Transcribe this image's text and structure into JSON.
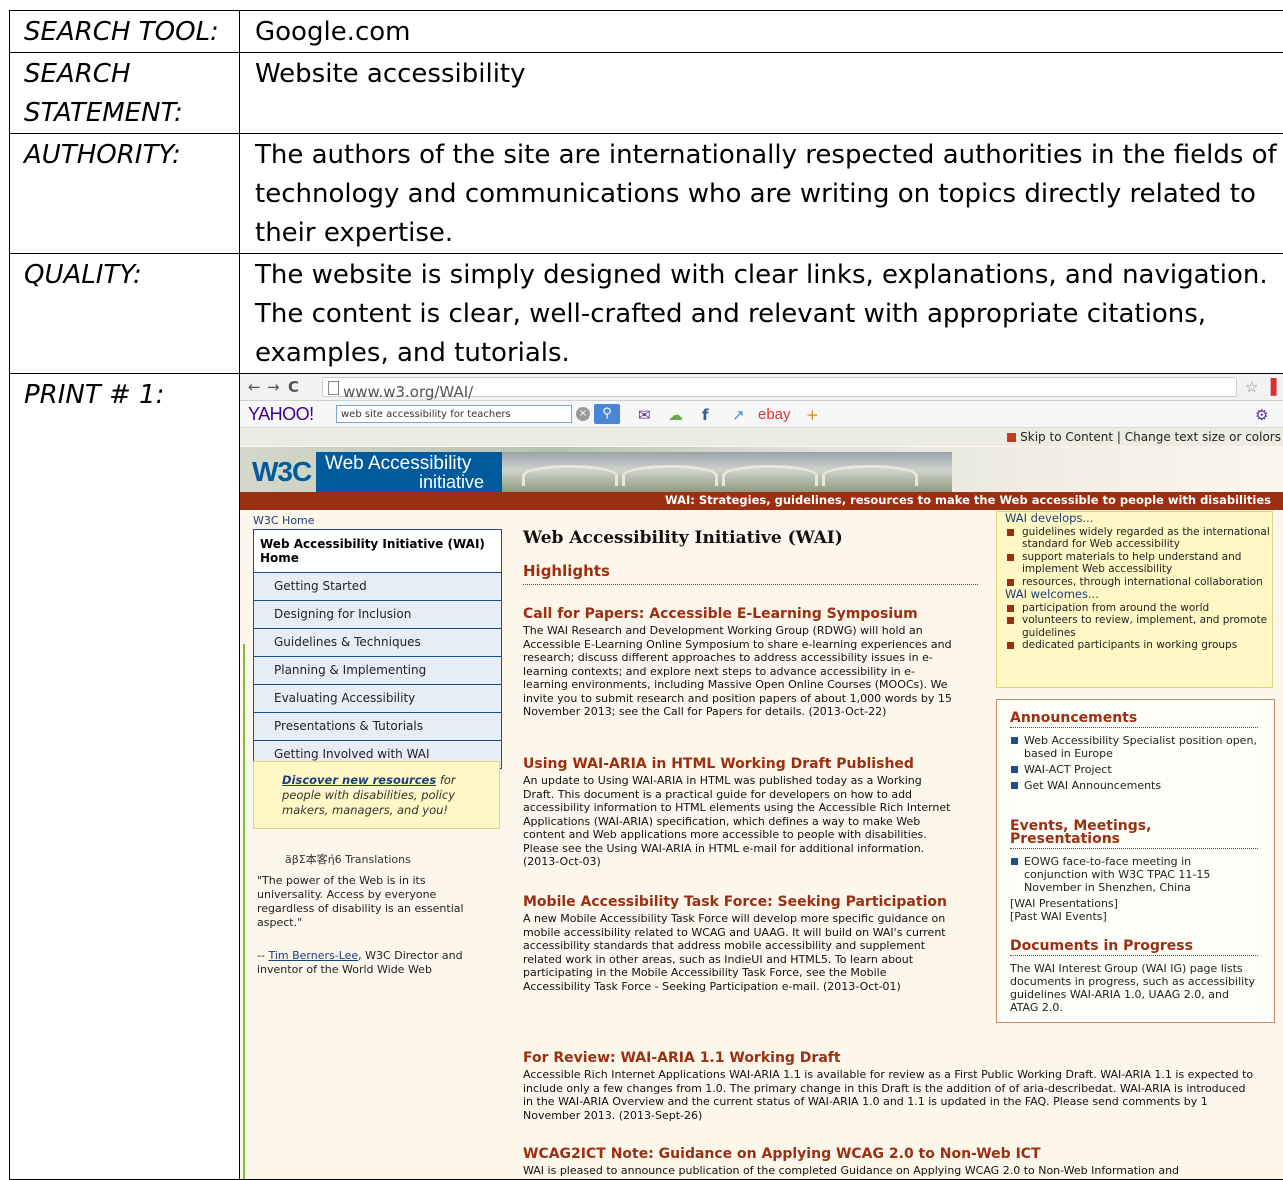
{
  "rows": [
    {
      "label": "SEARCH TOOL:",
      "value": "Google.com"
    },
    {
      "label": "SEARCH STATEMENT:",
      "value": "Website accessibility"
    },
    {
      "label": "AUTHORITY:",
      "value": "The authors of the site are internationally respected authorities in the fields of technology and communications who are writing on topics directly related to their expertise."
    },
    {
      "label": "QUALITY:",
      "value": "The website is simply designed with clear links, explanations, and navigation. The content is clear, well-crafted and relevant with appropriate citations, examples, and tutorials."
    },
    {
      "label": "PRINT # 1:"
    }
  ],
  "screenshot": {
    "browser": {
      "url": "www.w3.org/WAI/",
      "yahoo_logo": "YAHOO!",
      "yahoo_search": "web site accessibility for teachers",
      "ebay": "ebay"
    },
    "skip_bar": {
      "skip": "Skip to Content",
      "change": "| Change text size or colors"
    },
    "banner": {
      "w3c": "W3C",
      "title_line1": "Web Accessibility",
      "title_line2": "initiative",
      "strategies": "WAI: Strategies, guidelines, resources to make the Web accessible to people with disabilities"
    },
    "nav": {
      "home_link": "W3C Home",
      "head": "Web Accessibility Initiative (WAI) Home",
      "items": [
        "Getting Started",
        "Designing for Inclusion",
        "Guidelines & Techniques",
        "Planning & Implementing",
        "Evaluating Accessibility",
        "Presentations & Tutorials",
        "Getting Involved with WAI"
      ]
    },
    "discover": {
      "link": "Discover new resources",
      "rest": " for people with disabilities, policy makers, managers, and you!"
    },
    "translations": "äβΣ本客ή6 Translations",
    "quote": "\"The power of the Web is in its universality. Access by everyone regardless of disability is an essential aspect.\"",
    "quote_by_prefix": "-- ",
    "quote_by_link": "Tim Berners-Lee",
    "quote_by_rest": ", W3C Director and inventor of the World Wide Web",
    "main": {
      "title": "Web Accessibility Initiative (WAI)",
      "highlights": "Highlights",
      "items": [
        {
          "title": "Call for Papers: Accessible E-Learning Symposium",
          "body": "The WAI Research and Development Working Group (RDWG) will hold an Accessible E-Learning Online Symposium to share e-learning experiences and research; discuss different approaches to address accessibility issues in e-learning contexts; and explore next steps to advance accessibility in e-learning environments, including Massive Open Online Courses (MOOCs). We invite you to submit research and position papers of about 1,000 words by 15 November 2013; see the Call for Papers for details. (2013-Oct-22)"
        },
        {
          "title": "Using WAI-ARIA in HTML Working Draft Published",
          "body": "An update to Using WAI-ARIA in HTML was published today as a Working Draft. This document is a practical guide for developers on how to add accessibility information to HTML elements using the Accessible Rich Internet Applications (WAI-ARIA) specification, which defines a way to make Web content and Web applications more accessible to people with disabilities. Please see the Using WAI-ARIA in HTML e-mail for additional information.    (2013-Oct-03)"
        },
        {
          "title": "Mobile Accessibility Task Force: Seeking Participation",
          "body": "A new Mobile Accessibility Task Force will develop more specific guidance on mobile accessibility related to WCAG and UAAG. It will build on WAI's current accessibility standards that address mobile accessibility and supplement related work in other areas, such as IndieUI and HTML5. To learn about participating in the Mobile Accessibility Task Force, see the Mobile Accessibility Task Force - Seeking Participation e-mail.    (2013-Oct-01)"
        },
        {
          "title": "For Review: WAI-ARIA 1.1 Working Draft",
          "body": "Accessible Rich Internet Applications WAI-ARIA 1.1 is available for review as a First Public Working Draft. WAI-ARIA 1.1 is expected to include only a few changes from 1.0. The primary change in this Draft is the addition of of aria-describedat. WAI-ARIA is introduced in the WAI-ARIA Overview and the current status of WAI-ARIA 1.0 and 1.1 is updated in the FAQ. Please send comments by 1 November 2013.    (2013-Sept-26)"
        },
        {
          "title": "WCAG2ICT Note: Guidance on Applying WCAG 2.0 to Non-Web ICT",
          "body": "WAI is pleased to announce publication of the completed Guidance on Applying WCAG 2.0 to Non-Web Information and"
        }
      ]
    },
    "side_yellow": {
      "develops": "WAI develops...",
      "develops_items": [
        "guidelines widely regarded as the international standard for Web accessibility",
        "support materials to help understand and implement Web accessibility",
        "resources, through international collaboration"
      ],
      "welcomes": "WAI welcomes...",
      "welcomes_items": [
        "participation from around the world",
        "volunteers to review, implement, and promote guidelines",
        "dedicated participants in working groups"
      ]
    },
    "side": {
      "announcements": "Announcements",
      "ann_items": [
        "Web Accessibility Specialist position open, based in Europe",
        "WAI-ACT Project",
        "Get WAI Announcements"
      ],
      "events": "Events, Meetings, Presentations",
      "event_items": [
        "EOWG face-to-face meeting in conjunction with W3C TPAC 11-15 November in Shenzhen, China"
      ],
      "presentations": "[WAI Presentations]",
      "past": "[Past WAI Events]",
      "docs": "Documents in Progress",
      "docs_text": "The WAI Interest Group (WAI IG) page lists documents in progress, such as accessibility guidelines WAI-ARIA 1.0, UAAG 2.0, and ATAG 2.0."
    }
  }
}
